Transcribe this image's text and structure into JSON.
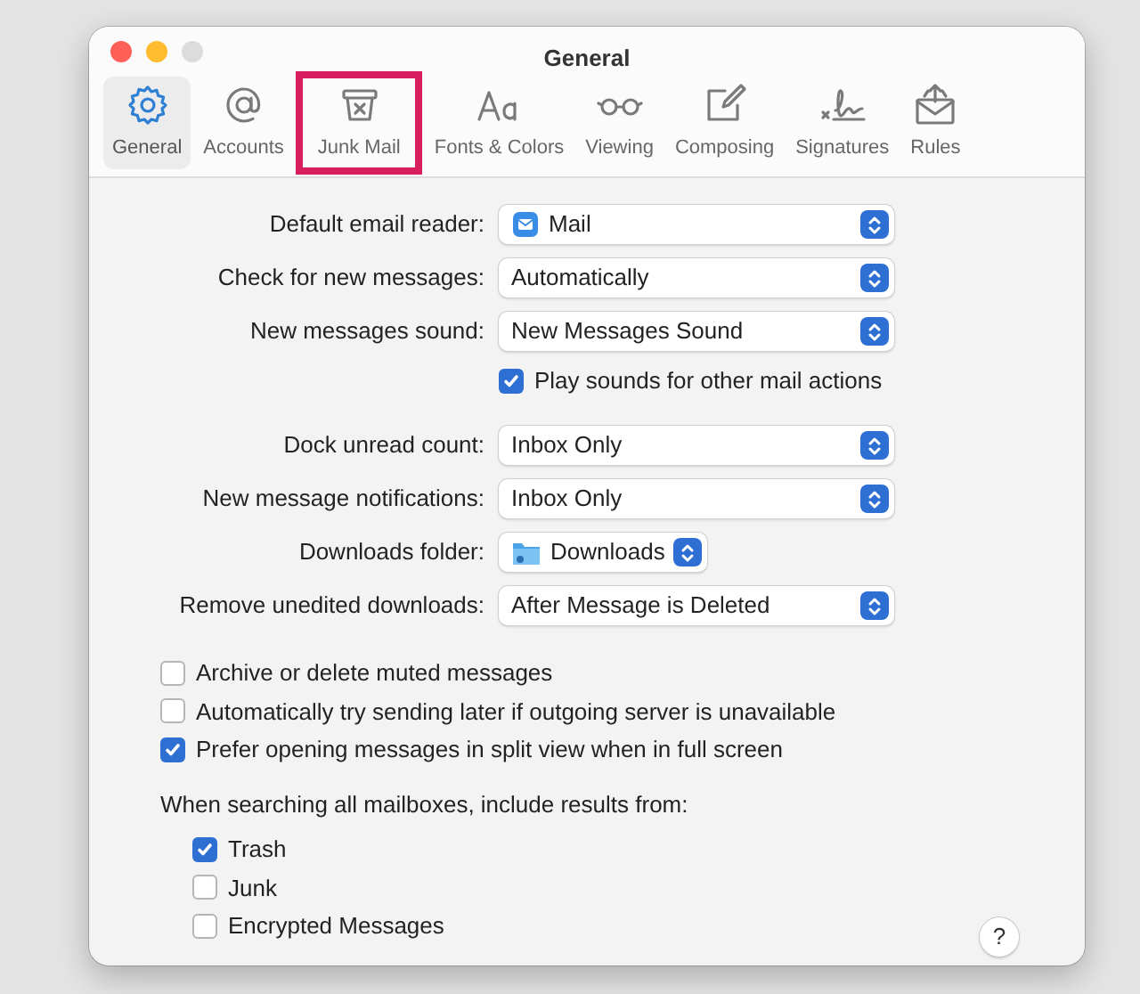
{
  "window": {
    "title": "General"
  },
  "toolbar": [
    {
      "label": "General",
      "selected": true,
      "highlighted": false
    },
    {
      "label": "Accounts",
      "selected": false,
      "highlighted": false
    },
    {
      "label": "Junk Mail",
      "selected": false,
      "highlighted": true
    },
    {
      "label": "Fonts & Colors",
      "selected": false,
      "highlighted": false
    },
    {
      "label": "Viewing",
      "selected": false,
      "highlighted": false
    },
    {
      "label": "Composing",
      "selected": false,
      "highlighted": false
    },
    {
      "label": "Signatures",
      "selected": false,
      "highlighted": false
    },
    {
      "label": "Rules",
      "selected": false,
      "highlighted": false
    }
  ],
  "settings_groups": [
    [
      {
        "kind": "app-popup",
        "label": "Default email reader:",
        "value": "Mail"
      },
      {
        "kind": "popup",
        "label": "Check for new messages:",
        "value": "Automatically"
      },
      {
        "kind": "popup",
        "label": "New messages sound:",
        "value": "New Messages Sound"
      },
      {
        "kind": "checkbox",
        "label": "Play sounds for other mail actions",
        "checked": true
      }
    ],
    [
      {
        "kind": "popup",
        "label": "Dock unread count:",
        "value": "Inbox Only"
      },
      {
        "kind": "popup",
        "label": "New message notifications:",
        "value": "Inbox Only"
      },
      {
        "kind": "folder-popup",
        "label": "Downloads folder:",
        "value": "Downloads"
      },
      {
        "kind": "popup",
        "label": "Remove unedited downloads:",
        "value": "After Message is Deleted"
      }
    ]
  ],
  "options": [
    {
      "label": "Archive or delete muted messages",
      "checked": false
    },
    {
      "label": "Automatically try sending later if outgoing server is unavailable",
      "checked": false
    },
    {
      "label": "Prefer opening messages in split view when in full screen",
      "checked": true
    }
  ],
  "search_section": {
    "heading": "When searching all mailboxes, include results from:",
    "options": [
      {
        "label": "Trash",
        "checked": true
      },
      {
        "label": "Junk",
        "checked": false
      },
      {
        "label": "Encrypted Messages",
        "checked": false
      }
    ]
  },
  "help_button": "?"
}
